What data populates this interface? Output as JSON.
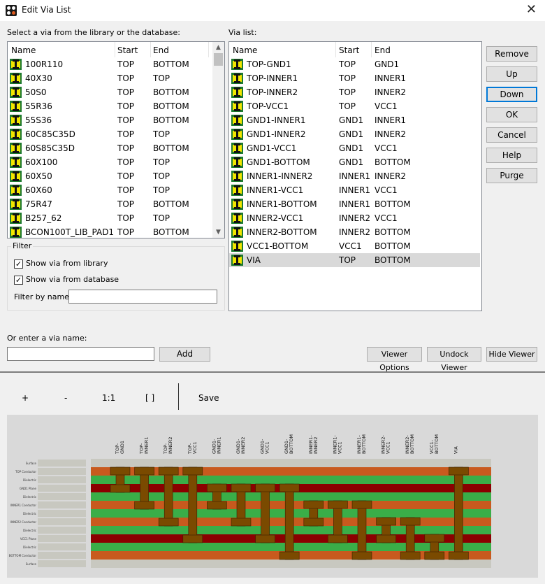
{
  "window": {
    "title": "Edit Via List",
    "close_label": "✕"
  },
  "library": {
    "caption": "Select a via from the library or the database:",
    "columns": [
      "Name",
      "Start",
      "End"
    ],
    "rows": [
      [
        "100R110",
        "TOP",
        "BOTTOM"
      ],
      [
        "40X30",
        "TOP",
        "TOP"
      ],
      [
        "50S0",
        "TOP",
        "BOTTOM"
      ],
      [
        "55R36",
        "TOP",
        "BOTTOM"
      ],
      [
        "55S36",
        "TOP",
        "BOTTOM"
      ],
      [
        "60C85C35D",
        "TOP",
        "TOP"
      ],
      [
        "60S85C35D",
        "TOP",
        "BOTTOM"
      ],
      [
        "60X100",
        "TOP",
        "TOP"
      ],
      [
        "60X50",
        "TOP",
        "TOP"
      ],
      [
        "60X60",
        "TOP",
        "TOP"
      ],
      [
        "75R47",
        "TOP",
        "BOTTOM"
      ],
      [
        "B257_62",
        "TOP",
        "TOP"
      ],
      [
        "BCON100T_LIB_PAD1",
        "TOP",
        "BOTTOM"
      ]
    ]
  },
  "vialist": {
    "caption": "Via list:",
    "columns": [
      "Name",
      "Start",
      "End"
    ],
    "rows": [
      [
        "TOP-GND1",
        "TOP",
        "GND1"
      ],
      [
        "TOP-INNER1",
        "TOP",
        "INNER1"
      ],
      [
        "TOP-INNER2",
        "TOP",
        "INNER2"
      ],
      [
        "TOP-VCC1",
        "TOP",
        "VCC1"
      ],
      [
        "GND1-INNER1",
        "GND1",
        "INNER1"
      ],
      [
        "GND1-INNER2",
        "GND1",
        "INNER2"
      ],
      [
        "GND1-VCC1",
        "GND1",
        "VCC1"
      ],
      [
        "GND1-BOTTOM",
        "GND1",
        "BOTTOM"
      ],
      [
        "INNER1-INNER2",
        "INNER1",
        "INNER2"
      ],
      [
        "INNER1-VCC1",
        "INNER1",
        "VCC1"
      ],
      [
        "INNER1-BOTTOM",
        "INNER1",
        "BOTTOM"
      ],
      [
        "INNER2-VCC1",
        "INNER2",
        "VCC1"
      ],
      [
        "INNER2-BOTTOM",
        "INNER2",
        "BOTTOM"
      ],
      [
        "VCC1-BOTTOM",
        "VCC1",
        "BOTTOM"
      ],
      [
        "VIA",
        "TOP",
        "BOTTOM"
      ]
    ],
    "selected_row": "VIA"
  },
  "buttons": {
    "remove": "Remove",
    "up": "Up",
    "down": "Down",
    "ok": "OK",
    "cancel": "Cancel",
    "help": "Help",
    "purge": "Purge"
  },
  "filter": {
    "title": "Filter",
    "show_library": "Show via from library",
    "show_library_checked": true,
    "show_database": "Show via from database",
    "show_database_checked": true,
    "by_name_label": "Filter by name:",
    "by_name_value": ""
  },
  "enter": {
    "label": "Or enter a via name:",
    "value": "",
    "add_label": "Add"
  },
  "viewer_buttons": {
    "options": "Viewer Options",
    "undock": "Undock Viewer",
    "hide": "Hide Viewer"
  },
  "viewer_toolbar": {
    "zoom_in": "+",
    "zoom_out": "-",
    "one_to_one": "1:1",
    "fit": "[ ]",
    "save": "Save"
  },
  "colors": {
    "conductor": "#c85a1e",
    "dielectric": "#3aae48",
    "plane": "#8b0000",
    "surface": "#c8c8c0",
    "via": "#7a4a00",
    "selection": "#d9d9d9",
    "accent": "#0078d7"
  },
  "stackup": {
    "layers": [
      {
        "name": "Surface",
        "kind": "surface"
      },
      {
        "name": "TOP Conductor",
        "kind": "conductor"
      },
      {
        "name": "Dielectric",
        "kind": "dielectric"
      },
      {
        "name": "GND1 Plane",
        "kind": "plane"
      },
      {
        "name": "Dielectric",
        "kind": "dielectric"
      },
      {
        "name": "INNER1 Conductor",
        "kind": "conductor"
      },
      {
        "name": "Dielectric",
        "kind": "dielectric"
      },
      {
        "name": "INNER2 Conductor",
        "kind": "conductor"
      },
      {
        "name": "Dielectric",
        "kind": "dielectric"
      },
      {
        "name": "VCC1 Plane",
        "kind": "plane"
      },
      {
        "name": "Dielectric",
        "kind": "dielectric"
      },
      {
        "name": "BOTTOM Conductor",
        "kind": "conductor"
      },
      {
        "name": "Surface",
        "kind": "surface"
      }
    ],
    "vias": [
      {
        "label": "TOP-GND1",
        "from": 1,
        "to": 3
      },
      {
        "label": "TOP-INNER1",
        "from": 1,
        "to": 5
      },
      {
        "label": "TOP-INNER2",
        "from": 1,
        "to": 7
      },
      {
        "label": "TOP-VCC1",
        "from": 1,
        "to": 9
      },
      {
        "label": "GND1-INNER1",
        "from": 3,
        "to": 5
      },
      {
        "label": "GND1-INNER2",
        "from": 3,
        "to": 7
      },
      {
        "label": "GND1-VCC1",
        "from": 3,
        "to": 9
      },
      {
        "label": "GND1-BOTTOM",
        "from": 3,
        "to": 11
      },
      {
        "label": "INNER1-INNER2",
        "from": 5,
        "to": 7
      },
      {
        "label": "INNER1-VCC1",
        "from": 5,
        "to": 9
      },
      {
        "label": "INNER1-BOTTOM",
        "from": 5,
        "to": 11
      },
      {
        "label": "INNER2-VCC1",
        "from": 7,
        "to": 9
      },
      {
        "label": "INNER2-BOTTOM",
        "from": 7,
        "to": 11
      },
      {
        "label": "VCC1-BOTTOM",
        "from": 9,
        "to": 11
      },
      {
        "label": "VIA",
        "from": 1,
        "to": 11
      }
    ]
  }
}
